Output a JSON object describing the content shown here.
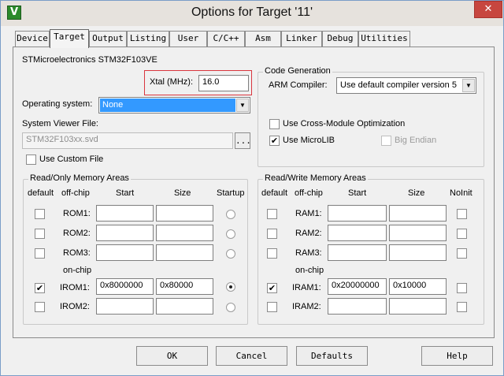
{
  "window": {
    "title": "Options for Target '11'",
    "icon": "keil-uvision-icon",
    "close_glyph": "✕"
  },
  "tabs": [
    {
      "label": "Device",
      "active": false
    },
    {
      "label": "Target",
      "active": true
    },
    {
      "label": "Output",
      "active": false
    },
    {
      "label": "Listing",
      "active": false
    },
    {
      "label": "User",
      "active": false
    },
    {
      "label": "C/C++",
      "active": false
    },
    {
      "label": "Asm",
      "active": false
    },
    {
      "label": "Linker",
      "active": false
    },
    {
      "label": "Debug",
      "active": false
    },
    {
      "label": "Utilities",
      "active": false
    }
  ],
  "target": {
    "device_name": "STMicroelectronics STM32F103VE",
    "xtal_label": "Xtal (MHz):",
    "xtal_value": "16.0",
    "os_label": "Operating system:",
    "os_value": "None",
    "svd_label": "System Viewer File:",
    "svd_value": "STM32F103xx.svd",
    "browse_label": "...",
    "use_custom_file_label": "Use Custom File",
    "use_custom_file_checked": false
  },
  "code_gen": {
    "title": "Code Generation",
    "compiler_label": "ARM Compiler:",
    "compiler_value": "Use default compiler version 5",
    "cross_module_label": "Use Cross-Module Optimization",
    "cross_module_checked": false,
    "microlib_label": "Use MicroLIB",
    "microlib_checked": true,
    "big_endian_label": "Big Endian",
    "big_endian_checked": false
  },
  "ro_memory": {
    "title": "Read/Only Memory Areas",
    "headers": {
      "default": "default",
      "offchip": "off-chip",
      "start": "Start",
      "size": "Size",
      "startup": "Startup"
    },
    "onchip_label": "on-chip",
    "rows": [
      {
        "name": "ROM1:",
        "default": false,
        "start": "",
        "size": "",
        "startup": false
      },
      {
        "name": "ROM2:",
        "default": false,
        "start": "",
        "size": "",
        "startup": false
      },
      {
        "name": "ROM3:",
        "default": false,
        "start": "",
        "size": "",
        "startup": false
      },
      {
        "name": "IROM1:",
        "default": true,
        "start": "0x8000000",
        "size": "0x80000",
        "startup": true
      },
      {
        "name": "IROM2:",
        "default": false,
        "start": "",
        "size": "",
        "startup": false
      }
    ]
  },
  "rw_memory": {
    "title": "Read/Write Memory Areas",
    "headers": {
      "default": "default",
      "offchip": "off-chip",
      "start": "Start",
      "size": "Size",
      "noinit": "NoInit"
    },
    "onchip_label": "on-chip",
    "rows": [
      {
        "name": "RAM1:",
        "default": false,
        "start": "",
        "size": "",
        "noinit": false
      },
      {
        "name": "RAM2:",
        "default": false,
        "start": "",
        "size": "",
        "noinit": false
      },
      {
        "name": "RAM3:",
        "default": false,
        "start": "",
        "size": "",
        "noinit": false
      },
      {
        "name": "IRAM1:",
        "default": true,
        "start": "0x20000000",
        "size": "0x10000",
        "noinit": false
      },
      {
        "name": "IRAM2:",
        "default": false,
        "start": "",
        "size": "",
        "noinit": false
      }
    ]
  },
  "buttons": {
    "ok": "OK",
    "cancel": "Cancel",
    "defaults": "Defaults",
    "help": "Help"
  },
  "glyphs": {
    "check": "✔",
    "dropdown": "▼"
  },
  "colors": {
    "selection": "#3399ff",
    "highlight_box": "#d9363e",
    "close_button": "#c7463f"
  }
}
